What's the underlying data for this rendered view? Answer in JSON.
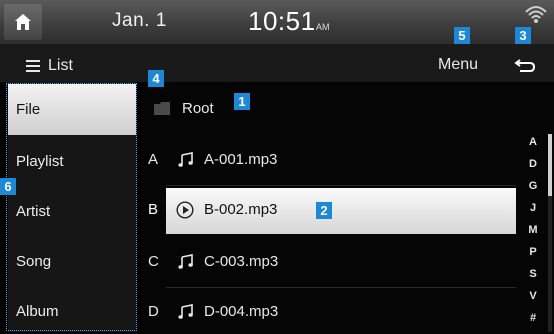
{
  "status": {
    "date": "Jan.  1",
    "time": "10:51",
    "ampm": "AM"
  },
  "toolbar": {
    "list_label": "List",
    "menu_label": "Menu"
  },
  "badges": {
    "b1": "1",
    "b2": "2",
    "b3": "3",
    "b4": "4",
    "b5": "5",
    "b6": "6"
  },
  "sidebar": {
    "items": [
      {
        "label": "File",
        "selected": true
      },
      {
        "label": "Playlist"
      },
      {
        "label": "Artist"
      },
      {
        "label": "Song"
      },
      {
        "label": "Album"
      }
    ]
  },
  "browser": {
    "root_label": "Root",
    "rows": [
      {
        "letter": "A",
        "name": "A-001.mp3",
        "icon": "music-note-icon"
      },
      {
        "letter": "B",
        "name": "B-002.mp3",
        "icon": "play-circle-icon",
        "selected": true
      },
      {
        "letter": "C",
        "name": "C-003.mp3",
        "icon": "music-note-icon"
      },
      {
        "letter": "D",
        "name": "D-004.mp3",
        "icon": "music-note-icon"
      }
    ]
  },
  "index_letters": [
    "A",
    "D",
    "G",
    "J",
    "M",
    "P",
    "S",
    "V",
    "#"
  ],
  "colors": {
    "badge": "#1d88d6",
    "outline": "#4aa6e8"
  }
}
